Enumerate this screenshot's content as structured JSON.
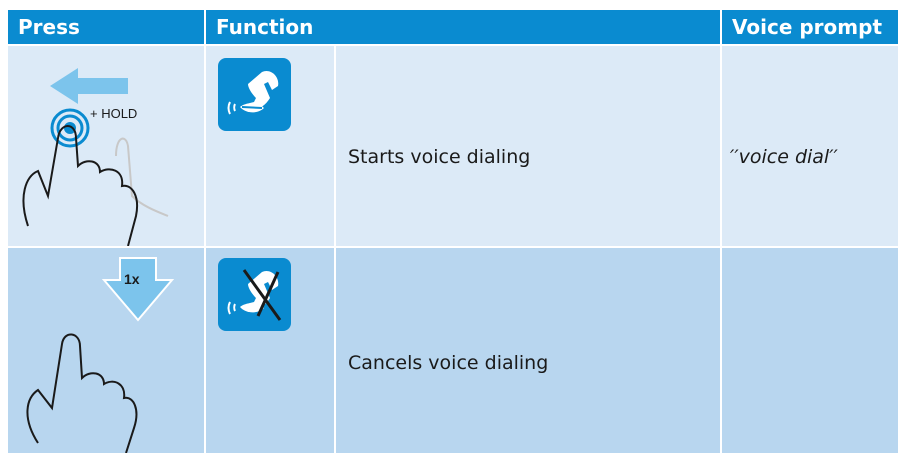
{
  "header": {
    "press": "Press",
    "function": "Function",
    "voice_prompt": "Voice prompt"
  },
  "rows": [
    {
      "gesture_label": "+ HOLD",
      "icon": "voice-dial-icon",
      "function": "Starts voice dialing",
      "voice_prompt": "′′voice dial′′"
    },
    {
      "gesture_label": "1x",
      "icon": "cancel-voice-dial-icon",
      "function": "Cancels voice dialing",
      "voice_prompt": ""
    }
  ],
  "colors": {
    "header": "#0a8bd0",
    "row1": "#dceaf7",
    "row2": "#b8d6ef",
    "arrow": "#7cc4ec"
  }
}
